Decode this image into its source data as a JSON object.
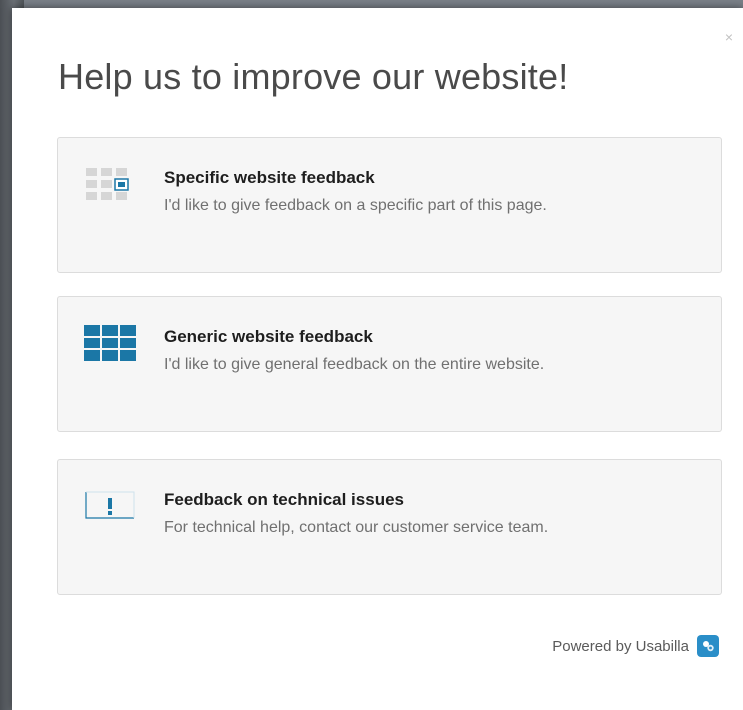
{
  "modal": {
    "title": "Help us to improve our website!",
    "close_label": "×"
  },
  "options": [
    {
      "title": "Specific website feedback",
      "description": "I'd like to give feedback on a specific part of this page.",
      "icon": "specific-feedback-icon"
    },
    {
      "title": "Generic website feedback",
      "description": "I'd like to give general feedback on the entire website.",
      "icon": "generic-feedback-icon"
    },
    {
      "title": "Feedback on technical issues",
      "description": "For technical help, contact our customer service team.",
      "icon": "technical-issue-icon"
    }
  ],
  "footer": {
    "powered_by": "Powered by Usabilla",
    "logo_icon": "usabilla-logo-icon"
  },
  "colors": {
    "accent": "#1b77a6",
    "icon_gray": "#d6d6d6",
    "option_bg": "#f6f6f6",
    "logo_bg": "#2a8ec8"
  }
}
